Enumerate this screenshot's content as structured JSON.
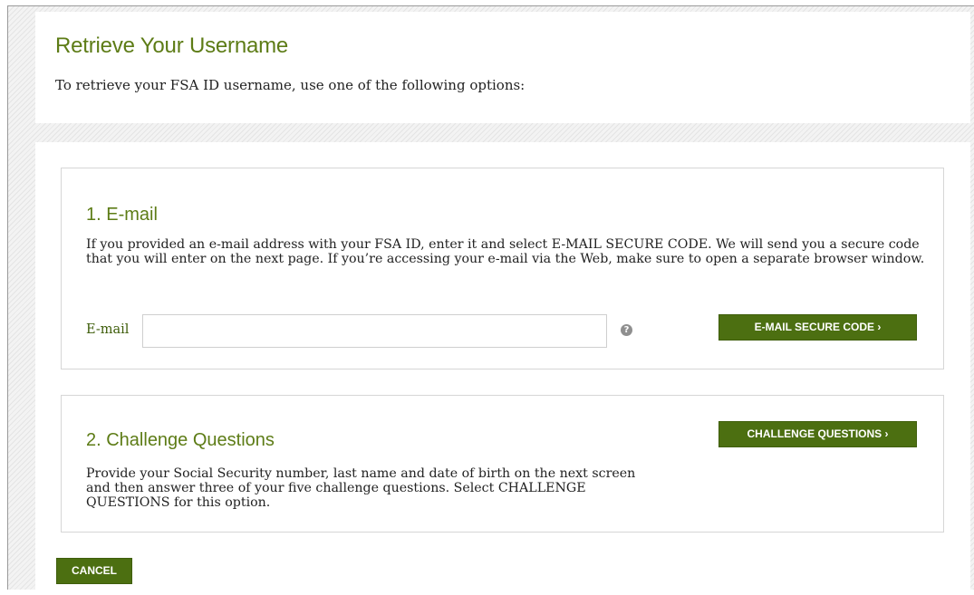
{
  "header": {
    "title": "Retrieve Your Username",
    "intro": "To retrieve your FSA ID username, use one of the following options:"
  },
  "email_option": {
    "title": "1. E-mail",
    "description": "If you provided an e-mail address with your FSA ID, enter it and select E-MAIL SECURE CODE. We will send you a secure code that you will enter on the next page. If you’re accessing your e-mail via the Web, make sure to open a separate browser window.",
    "field_label": "E-mail",
    "field_value": "",
    "help_icon": "question-circle-icon",
    "help_glyph": "?",
    "button_label": "E-MAIL SECURE CODE ›"
  },
  "challenge_option": {
    "title": "2. Challenge Questions",
    "description": "Provide your Social Security number, last name and date of birth on the next screen and then answer three of your five challenge questions. Select CHALLENGE QUESTIONS for this option.",
    "button_label": "CHALLENGE QUESTIONS ›"
  },
  "footer": {
    "cancel_label": "CANCEL"
  },
  "colors": {
    "accent_green": "#5d7c16",
    "button_green": "#4c6f11"
  }
}
